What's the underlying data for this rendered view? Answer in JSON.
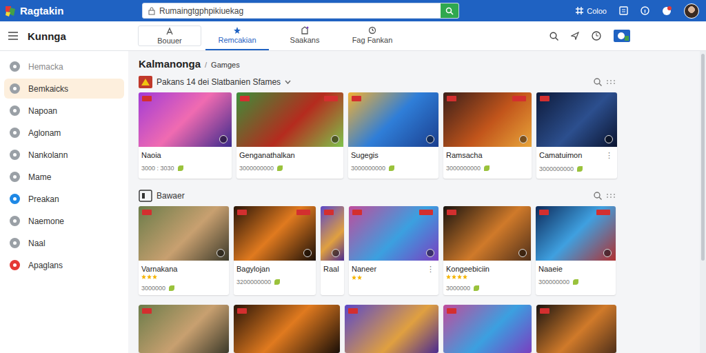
{
  "header": {
    "logo": "Ragtakin",
    "search": {
      "value": "Rumaingtgphpikiuekag"
    },
    "account": "Coloo"
  },
  "nav": {
    "title": "Kunnga",
    "tabs": [
      {
        "label": "Bouuer",
        "selected": false
      },
      {
        "label": "Remcakian",
        "selected": true
      },
      {
        "label": "Saakans",
        "selected": false
      },
      {
        "label": "Fag Fankan",
        "selected": false
      }
    ]
  },
  "sidebar": {
    "items": [
      {
        "label": "Hemacka",
        "selected": false,
        "color": "#9aa0a6"
      },
      {
        "label": "Bemkaicks",
        "selected": true,
        "color": "#9aa0a6"
      },
      {
        "label": "Napoan",
        "selected": false,
        "color": "#9aa0a6"
      },
      {
        "label": "Aglonam",
        "selected": false,
        "color": "#9aa0a6"
      },
      {
        "label": "Nankolann",
        "selected": false,
        "color": "#9aa0a6"
      },
      {
        "label": "Mame",
        "selected": false,
        "color": "#9aa0a6"
      },
      {
        "label": "Preakan",
        "selected": false,
        "color": "#1e88e5"
      },
      {
        "label": "Naemone",
        "selected": false,
        "color": "#9aa0a6"
      },
      {
        "label": "Naal",
        "selected": false,
        "color": "#9aa0a6"
      },
      {
        "label": "Apaglans",
        "selected": false,
        "color": "#e53935"
      }
    ]
  },
  "breadcrumb": {
    "title": "Kalmanonga",
    "separator": "/",
    "current": "Gamges"
  },
  "sections": [
    {
      "title": "Pakans 14 dei Slatbanien Sfames",
      "cards": [
        {
          "title": "Naoia",
          "meta": "3000 : 3030"
        },
        {
          "title": "Genganathalkan",
          "meta": "3000000000"
        },
        {
          "title": "Sugegis",
          "meta": "3000000000"
        },
        {
          "title": "Ramsacha",
          "meta": "3000000000"
        },
        {
          "title": "Camatuimon",
          "meta": "3000000000",
          "more": "⋮"
        }
      ]
    },
    {
      "title": "Bawaer",
      "cards": [
        {
          "title": "Varnakana",
          "stars": 3,
          "meta": "3000000"
        },
        {
          "title": "Bagylojan",
          "meta": "3200000000"
        },
        {
          "title": "Raal"
        },
        {
          "title": "Naneer",
          "stars": 2,
          "more": "⋮"
        },
        {
          "title": "Kongeebiciin",
          "stars": 4,
          "meta": "3000000"
        },
        {
          "title": "Naaeie",
          "meta": "300000000"
        }
      ]
    }
  ]
}
